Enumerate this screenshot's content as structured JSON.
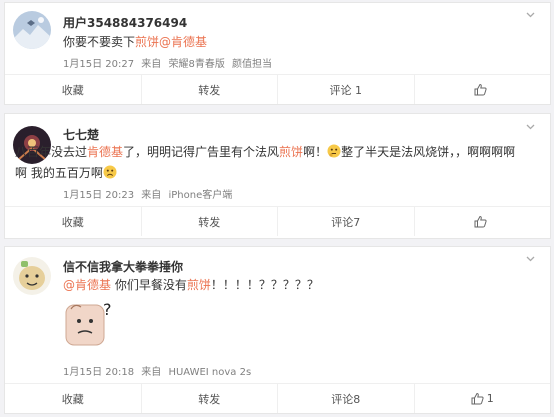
{
  "colors": {
    "accent": "#eb7350",
    "bg": "#f2f2f5"
  },
  "posts": [
    {
      "user": "用户354884376494",
      "text_parts": [
        "你要不要卖下",
        "煎饼",
        "@肯德基"
      ],
      "meta": {
        "date": "1月15日 20:27",
        "from": "来自",
        "device": "荣耀8青春版",
        "extra": "颜值担当"
      },
      "actions": {
        "collect": "收藏",
        "repost": "转发",
        "comment": "评论 1",
        "like": ""
      }
    },
    {
      "user": "七七楚",
      "text_parts": [
        "八百年没去过",
        "肯德基",
        "了，明明记得广告里有个法风",
        "煎饼",
        "啊！",
        "整了半天是法风烧饼，，啊啊啊啊",
        "啊 我的五百万啊"
      ],
      "meta": {
        "date": "1月15日 20:23",
        "from": "来自",
        "device": "iPhone客户端"
      },
      "actions": {
        "collect": "收藏",
        "repost": "转发",
        "comment": "评论7",
        "like": ""
      }
    },
    {
      "user": "信不信我拿大拳拳捶你",
      "text_parts": [
        "@肯德基",
        " 你们早餐没有",
        "煎饼",
        "！！！！？？？？？"
      ],
      "meta": {
        "date": "1月15日 20:18",
        "from": "来自",
        "device": "HUAWEI nova 2s"
      },
      "actions": {
        "collect": "收藏",
        "repost": "转发",
        "comment": "评论8",
        "like": "1"
      }
    }
  ],
  "icons": [
    "chevron-down-icon",
    "thumbs-up-icon",
    "thinking-emoji-icon",
    "sad-emoji-icon",
    "sticker-icon"
  ]
}
